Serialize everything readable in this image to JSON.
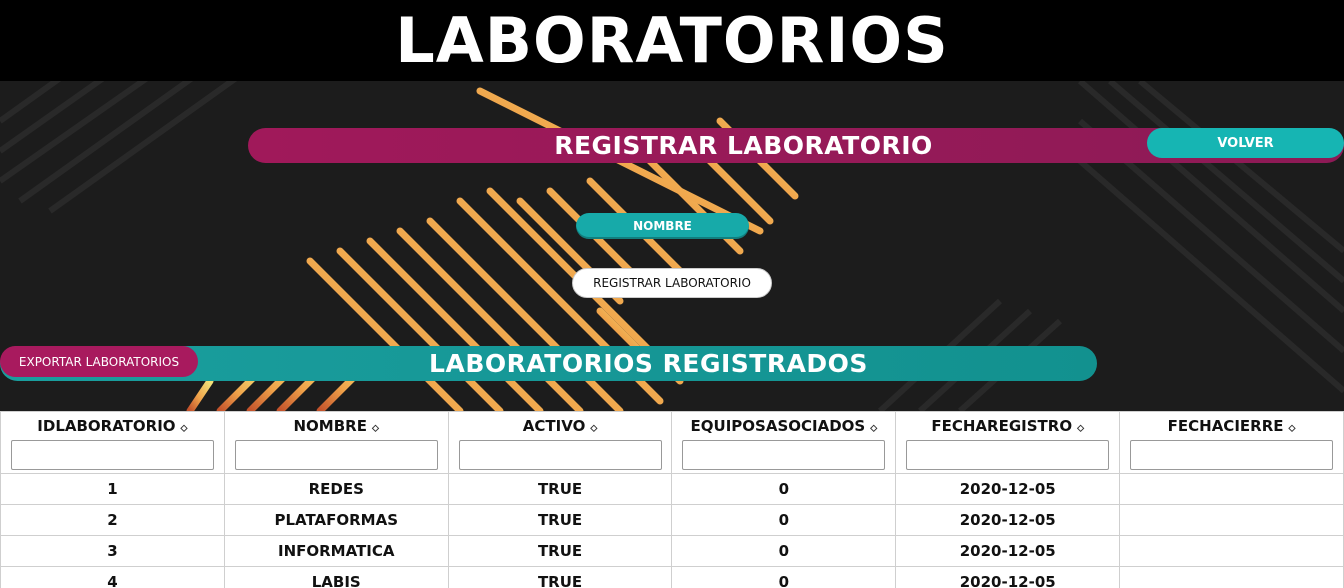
{
  "page": {
    "title": "LABORATORIOS"
  },
  "register_section": {
    "title": "REGISTRAR LABORATORIO",
    "back_button": "VOLVER",
    "name_field_label": "NOMBRE",
    "submit_button": "REGISTRAR LABORATORIO"
  },
  "list_section": {
    "title": "LABORATORIOS REGISTRADOS",
    "export_button": "EXPORTAR LABORATORIOS"
  },
  "table": {
    "columns": [
      "IDLABORATORIO",
      "NOMBRE",
      "ACTIVO",
      "EQUIPOSASOCIADOS",
      "FECHAREGISTRO",
      "FECHACIERRE"
    ],
    "sort_icon": "⬦",
    "rows": [
      [
        "1",
        "REDES",
        "TRUE",
        "0",
        "2020-12-05",
        ""
      ],
      [
        "2",
        "PLATAFORMAS",
        "TRUE",
        "0",
        "2020-12-05",
        ""
      ],
      [
        "3",
        "INFORMATICA",
        "TRUE",
        "0",
        "2020-12-05",
        ""
      ],
      [
        "4",
        "LABIS",
        "TRUE",
        "0",
        "2020-12-05",
        ""
      ]
    ]
  },
  "colors": {
    "magenta": "#a0195a",
    "teal": "#16b5b3",
    "header_black": "#000000",
    "hero_dark": "#1c1c1c"
  }
}
